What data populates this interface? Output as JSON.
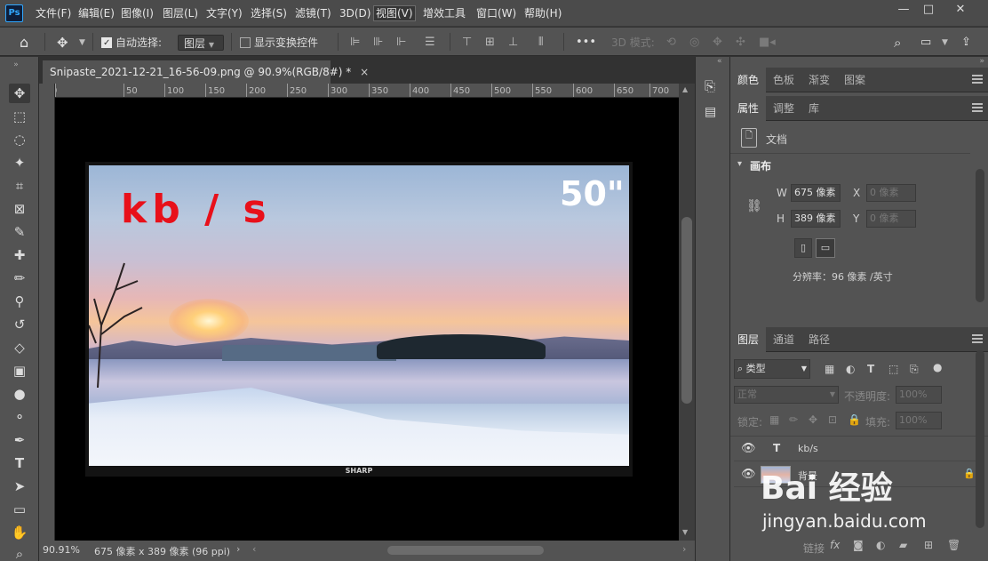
{
  "app": {
    "logo": "Ps"
  },
  "menu": [
    "文件(F)",
    "编辑(E)",
    "图像(I)",
    "图层(L)",
    "文字(Y)",
    "选择(S)",
    "滤镜(T)",
    "3D(D)",
    "视图(V)",
    "增效工具",
    "窗口(W)",
    "帮助(H)"
  ],
  "window_controls": {
    "minimize": "—",
    "maximize": "□",
    "close": "✕"
  },
  "options": {
    "auto_select_label": "自动选择:",
    "auto_select_value": "图层",
    "show_transform_label": "显示变换控件",
    "more": "•••",
    "mode_3d_label": "3D 模式:"
  },
  "document": {
    "tab_title": "Snipaste_2021-12-21_16-56-09.png @ 90.9%(RGB/8#) *",
    "tab_close": "×",
    "ruler_ticks": [
      "0",
      "50",
      "100",
      "150",
      "200",
      "250",
      "300",
      "350",
      "400",
      "450",
      "500",
      "550",
      "600",
      "650",
      "700"
    ],
    "zoom": "90.91%",
    "doc_info": "675 像素 x 389 像素 (96 ppi)",
    "status_arrow": "›"
  },
  "image": {
    "overlay_text": "kb / s",
    "size_text": "50\"",
    "brand": "SHARP"
  },
  "panels": {
    "top_tabs": [
      "颜色",
      "色板",
      "渐变",
      "图案"
    ],
    "prop_tabs": [
      "属性",
      "调整",
      "库"
    ],
    "doc_label": "文档",
    "canvas_section": "画布",
    "w_label": "W",
    "w_value": "675 像素",
    "h_label": "H",
    "h_value": "389 像素",
    "x_label": "X",
    "x_value": "0 像素",
    "y_label": "Y",
    "y_value": "0 像素",
    "resolution": "分辨率：96 像素 /英寸",
    "layers_tabs": [
      "图层",
      "通道",
      "路径"
    ],
    "filter_kind": "类型",
    "blend_mode": "正常",
    "opacity_label": "不透明度:",
    "opacity_value": "100%",
    "lock_label": "锁定:",
    "fill_label": "填充:",
    "fill_value": "100%",
    "layers": [
      {
        "name": "kb/s",
        "type": "text"
      },
      {
        "name": "背景",
        "type": "image"
      }
    ],
    "bottom_icons": [
      "链接",
      "fx"
    ]
  },
  "watermark": {
    "brand": "Bai 经验",
    "url": "jingyan.baidu.com"
  }
}
